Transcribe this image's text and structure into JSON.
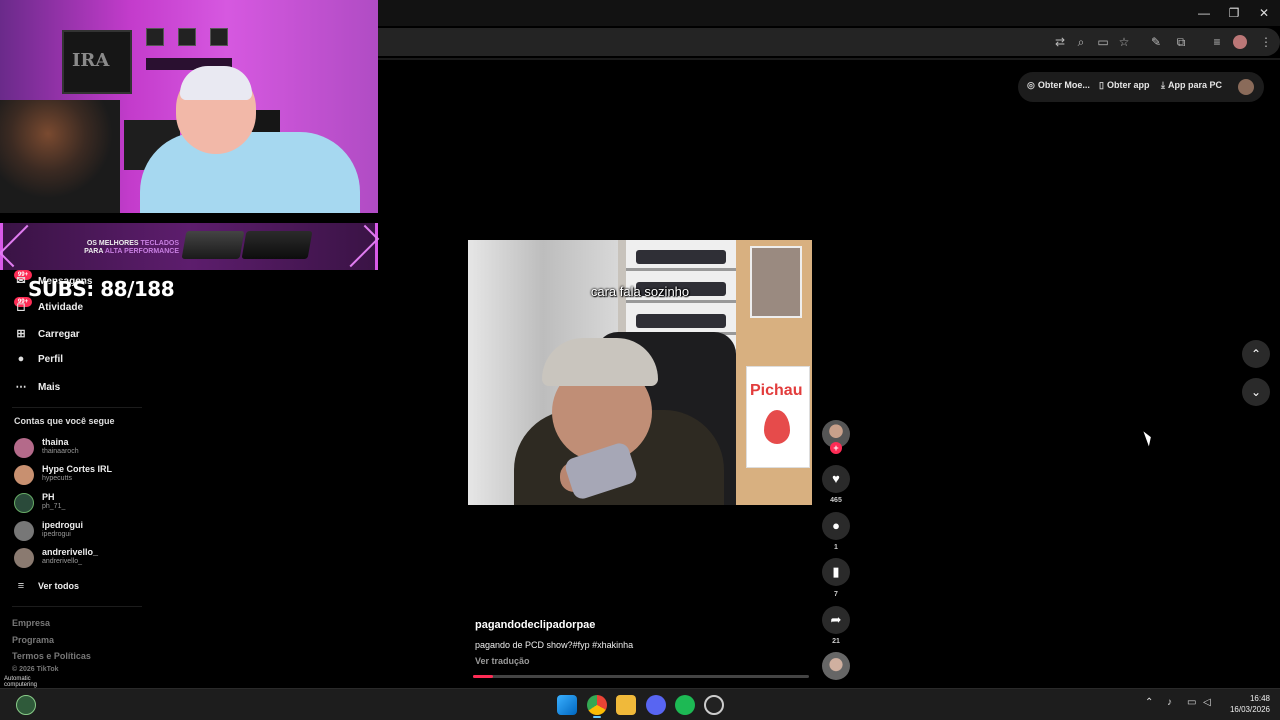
{
  "browser": {
    "window_controls": [
      "—",
      "❐",
      "✕"
    ],
    "toolbar_icons": [
      "translate-icon",
      "zoom-icon",
      "cast-icon",
      "bookmark-star-icon",
      "pen-icon",
      "extensions-icon",
      "media-controls-icon",
      "profile-avatar",
      "menu-icon"
    ]
  },
  "top_actions": {
    "coins": "Obter Moe...",
    "app": "Obter app",
    "pc_app": "App para PC"
  },
  "overlay": {
    "banner_line1_white": "OS MELHORES ",
    "banner_line1_accent": "TECLADOS",
    "banner_line2_white": "PARA ",
    "banner_line2_accent": "ALTA PERFORMANCE",
    "subs": "SUBS: 88/188",
    "cam_logo": "IRA"
  },
  "sidebar": {
    "badges": [
      "99+",
      "99+"
    ],
    "items": [
      {
        "label": "Mensagens",
        "icon": "messages-icon"
      },
      {
        "label": "Atividade",
        "icon": "activity-icon"
      },
      {
        "label": "Carregar",
        "icon": "upload-icon"
      },
      {
        "label": "Perfil",
        "icon": "profile-icon"
      },
      {
        "label": "Mais",
        "icon": "more-icon"
      }
    ],
    "following_title": "Contas que você segue",
    "following": [
      {
        "name": "thaina",
        "handle": "thainaaroch"
      },
      {
        "name": "Hype Cortes IRL",
        "handle": "hypecutts"
      },
      {
        "name": "PH",
        "handle": "ph_71_"
      },
      {
        "name": "ipedrogui",
        "handle": "ipedrogui"
      },
      {
        "name": "andrerivello_",
        "handle": "andrerivello_"
      }
    ],
    "see_all": "Ver todos",
    "footer": [
      "Empresa",
      "Programa",
      "Termos e Políticas",
      "© 2026 TikTok"
    ]
  },
  "video": {
    "caption_overlay": "cara fala sozinho",
    "poster_brand": "Pichau",
    "author": "pagandodeclipadorpae",
    "description": "pagando de PCD show?#fyp #xhakinha",
    "translate": "Ver tradução",
    "progress": 0.06,
    "likes": "465",
    "comments": "1",
    "saves": "7",
    "shares": "21",
    "follow_plus": "+"
  },
  "navigation": {
    "up": "⌃",
    "down": "⌄"
  },
  "taskbar": {
    "left_label": "Automatic computering",
    "clock_time": "16:48",
    "clock_date": "16/03/2026",
    "apps": [
      "windows-start-icon",
      "chrome-icon",
      "file-explorer-icon",
      "discord-icon",
      "spotify-icon",
      "chatgpt-icon"
    ]
  },
  "colors": {
    "accent": "#fe2c55",
    "banner_accent": "#c77ee0"
  }
}
